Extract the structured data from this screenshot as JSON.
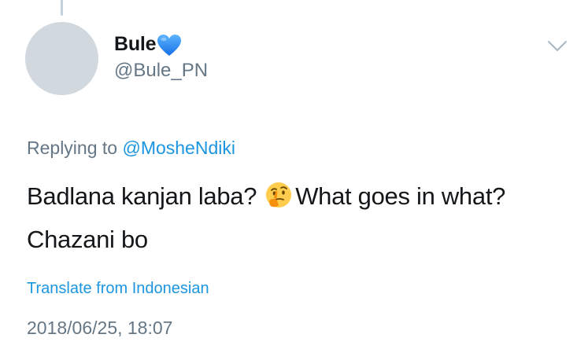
{
  "tweet": {
    "author": {
      "display_name": "Bule",
      "handle": "@Bule_PN",
      "name_emoji": "blue-heart-icon"
    },
    "replying_to": {
      "prefix": "Replying to",
      "mention": "@MosheNdiki"
    },
    "text": {
      "part1": "Badlana kanjan laba?",
      "emoji": "thinking-face-icon",
      "part2": "What goes in what? Chazani bo"
    },
    "translate_label": "Translate from Indonesian",
    "timestamp": "2018/06/25, 18:07"
  },
  "colors": {
    "text_primary": "#14171a",
    "text_secondary": "#657786",
    "link": "#1b95e0",
    "avatar_placeholder": "#d1d8de",
    "heart": "#1da1f2"
  }
}
